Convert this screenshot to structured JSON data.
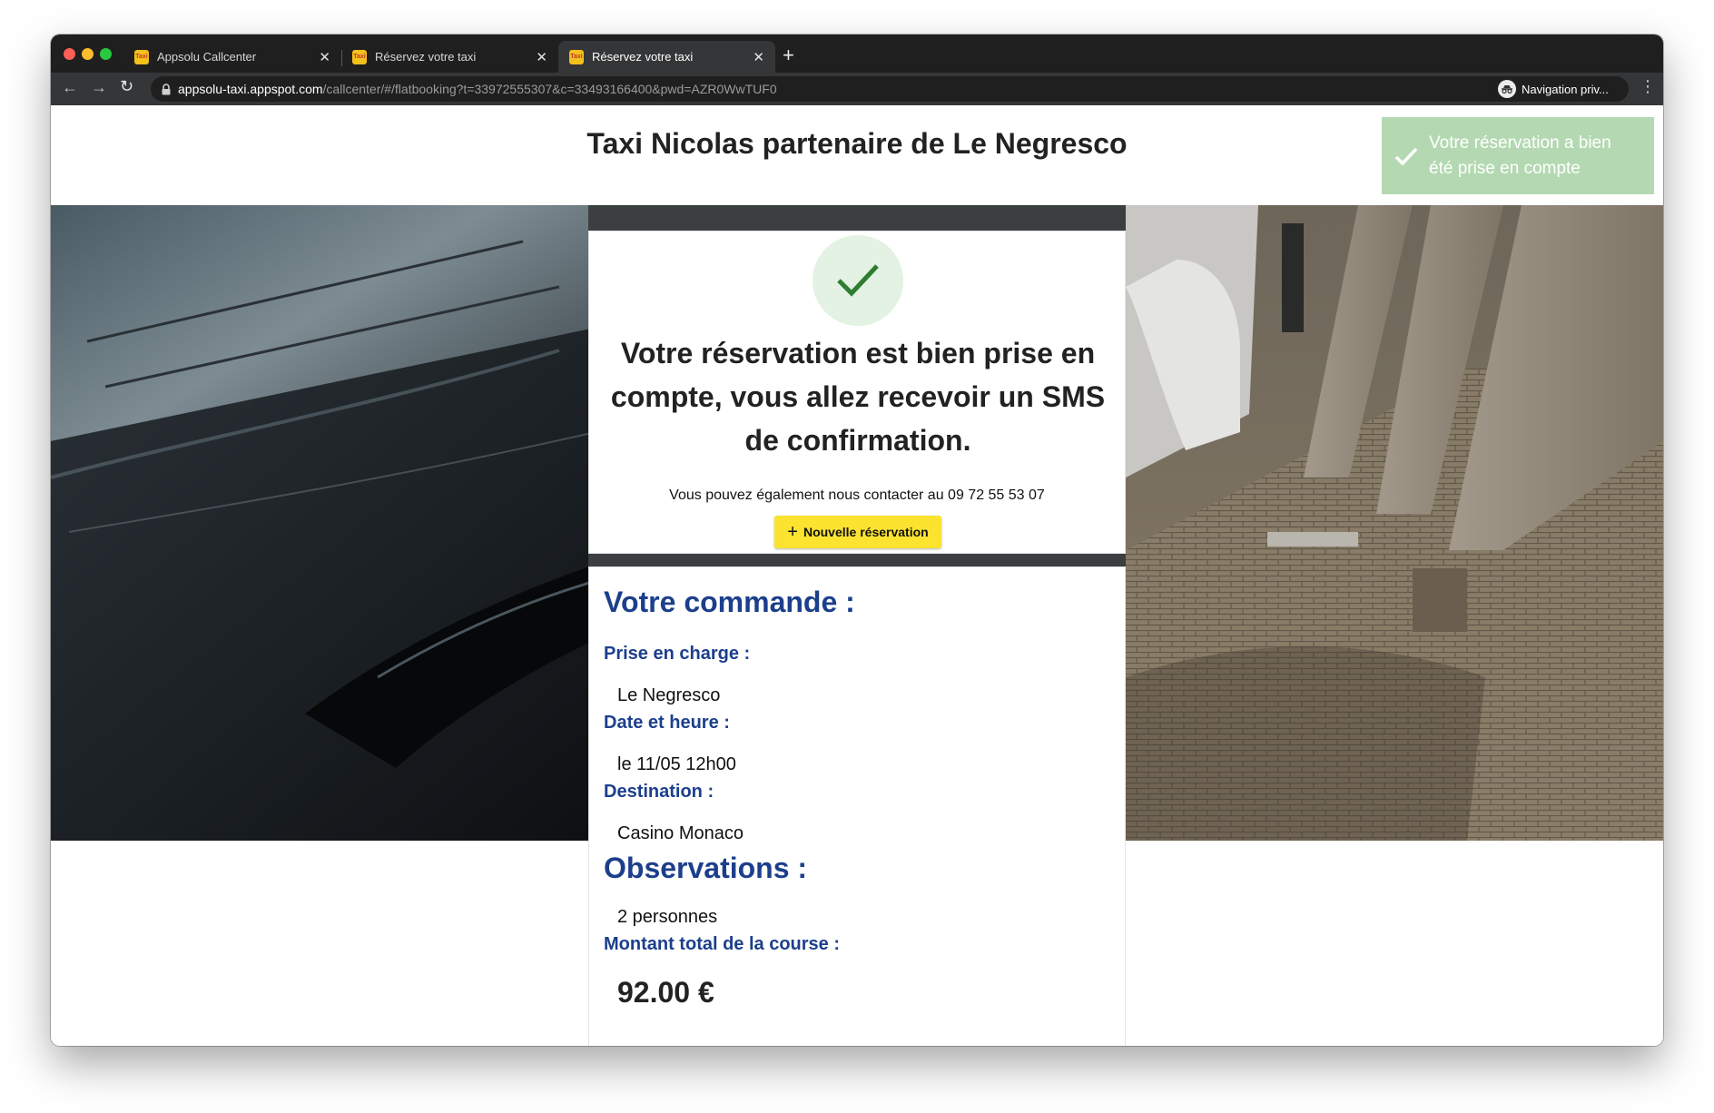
{
  "browser": {
    "tabs": [
      {
        "favicon": "Taxi",
        "title": "Appsolu Callcenter",
        "active": false
      },
      {
        "favicon": "Taxi",
        "title": "Réservez votre taxi",
        "active": false
      },
      {
        "favicon": "Taxi",
        "title": "Réservez votre taxi",
        "active": true
      }
    ],
    "url_host": "appsolu-taxi.appspot.com",
    "url_path": "/callcenter/#/flatbooking?t=33972555307&c=33493166400&pwd=AZR0WwTUF0",
    "profile_label": "Navigation priv..."
  },
  "page": {
    "title": "Taxi Nicolas partenaire de Le Negresco"
  },
  "toast": {
    "message": "Votre réservation a bien été prise en compte"
  },
  "confirmation": {
    "message": "Votre réservation est bien prise en compte, vous allez recevoir un SMS de confirmation.",
    "contact_prefix": "Vous pouvez également nous contacter au ",
    "phone": "09 72 55 53 07",
    "new_booking_label": "Nouvelle réservation"
  },
  "order": {
    "heading": "Votre commande :",
    "pickup_label": "Prise en charge :",
    "pickup_value": "Le Negresco",
    "datetime_label": "Date et heure :",
    "datetime_value": "le 11/05 12h00",
    "destination_label": "Destination :",
    "destination_value": "Casino Monaco",
    "observations_heading": "Observations :",
    "observations_value": "2 personnes",
    "total_label": "Montant total de la course :",
    "total_value": "92.00 €"
  },
  "colors": {
    "accent_blue": "#1c3f8c",
    "button_yellow": "#fce330",
    "success_green": "#2e7d32",
    "toast_green": "#b4d9b2"
  }
}
